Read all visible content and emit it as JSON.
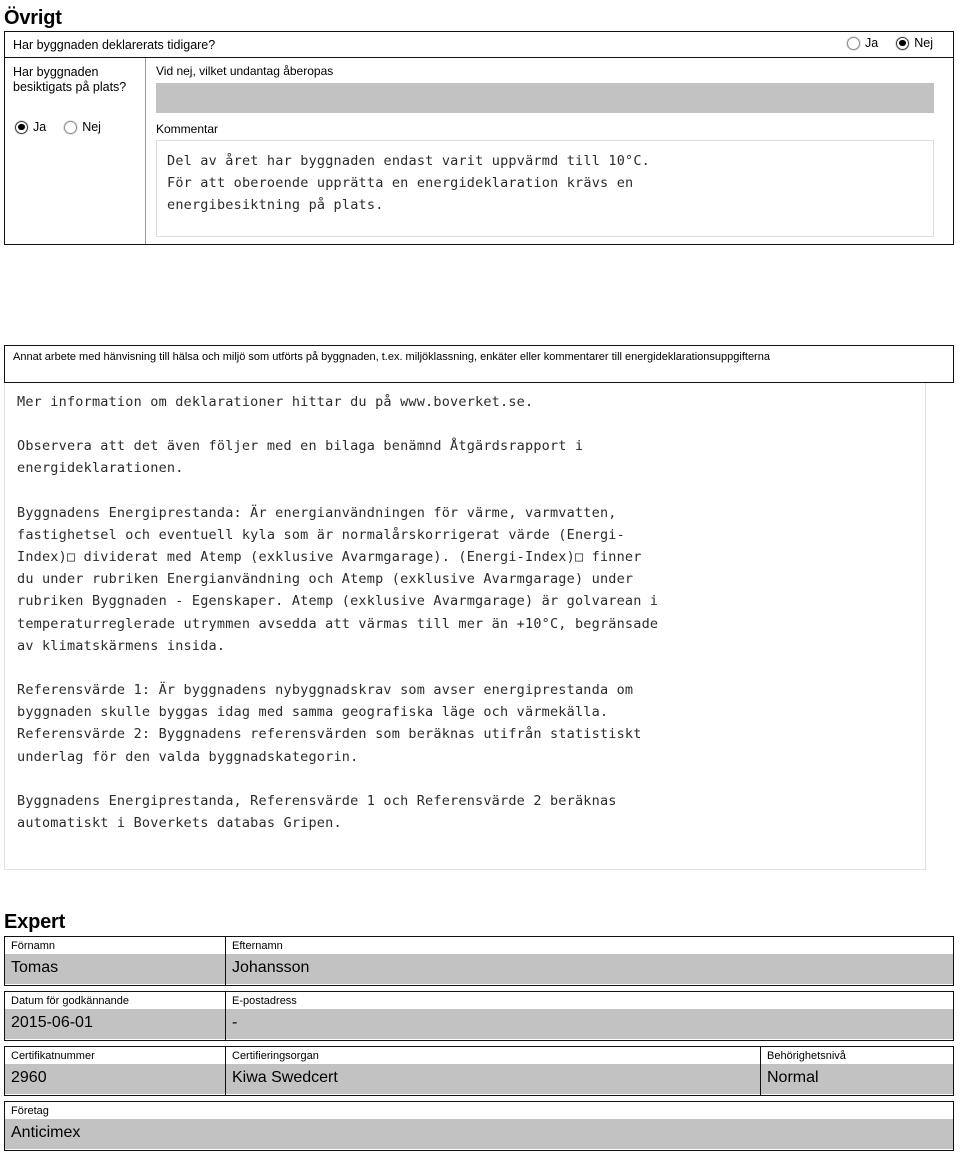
{
  "sections": {
    "ovrigt": {
      "title": "Övrigt",
      "declared_question": "Har byggnaden deklarerats tidigare?",
      "declared_options": [
        {
          "label": "Ja",
          "selected": false
        },
        {
          "label": "Nej",
          "selected": true
        }
      ],
      "inspected_question": "Har byggnaden besiktigats på plats?",
      "inspected_options": [
        {
          "label": "Ja",
          "selected": true
        },
        {
          "label": "Nej",
          "selected": false
        }
      ],
      "exception_label": "Vid nej, vilket undantag åberopas",
      "exception_value": "",
      "comment_label": "Kommentar",
      "comment_value": "Del av året har byggnaden endast varit uppvärmd till 10°C.\nFör att oberoende upprätta en energideklaration krävs en\nenergibesiktning på plats."
    },
    "annat": {
      "label": "Annat arbete med hänvisning till hälsa och miljö som utförts på byggnaden, t.ex. miljöklassning, enkäter eller kommentarer till energideklarationsuppgifterna",
      "paragraphs": [
        "Mer information om deklarationer hittar du på www.boverket.se.",
        "Observera att det även följer med en bilaga benämnd Åtgärdsrapport i\nenergideklarationen.",
        "Byggnadens Energiprestanda: Är energianvändningen för värme, varmvatten,\nfastighetsel och eventuell kyla som är normalårskorrigerat värde (Energi-\nIndex)□ dividerat med Atemp (exklusive Avarmgarage). (Energi-Index)□ finner\ndu under rubriken Energianvändning och Atemp (exklusive Avarmgarage) under\nrubriken Byggnaden - Egenskaper. Atemp (exklusive Avarmgarage) är golvarean i\ntemperaturreglerade utrymmen avsedda att värmas till mer än +10°C, begränsade\nav klimatskärmens insida.",
        "Referensvärde 1: Är byggnadens nybyggnadskrav som avser energiprestanda om\nbyggnaden skulle byggas idag med samma geografiska läge och värmekälla.\nReferensvärde 2: Byggnadens referensvärden som beräknas utifrån statistiskt\nunderlag för den valda byggnadskategorin.",
        "Byggnadens Energiprestanda, Referensvärde 1 och Referensvärde 2 beräknas\nautomatiskt i Boverkets databas Gripen."
      ]
    },
    "expert": {
      "title": "Expert",
      "rows": [
        {
          "cells": [
            {
              "label": "Förnamn",
              "value": "Tomas"
            },
            {
              "label": "Efternamn",
              "value": "Johansson"
            }
          ]
        },
        {
          "cells": [
            {
              "label": "Datum för godkännande",
              "value": "2015-06-01"
            },
            {
              "label": "E-postadress",
              "value": "-"
            }
          ]
        },
        {
          "cells": [
            {
              "label": "Certifikatnummer",
              "value": "2960"
            },
            {
              "label": "Certifieringsorgan",
              "value": "Kiwa Swedcert"
            },
            {
              "label": "Behörighetsnivå",
              "value": "Normal"
            }
          ]
        },
        {
          "cells": [
            {
              "label": "Företag",
              "value": "Anticimex"
            }
          ]
        }
      ]
    }
  },
  "colors": {
    "field_gray": "#c2c2c2",
    "border_dark": "#111111",
    "text": "#000000"
  }
}
